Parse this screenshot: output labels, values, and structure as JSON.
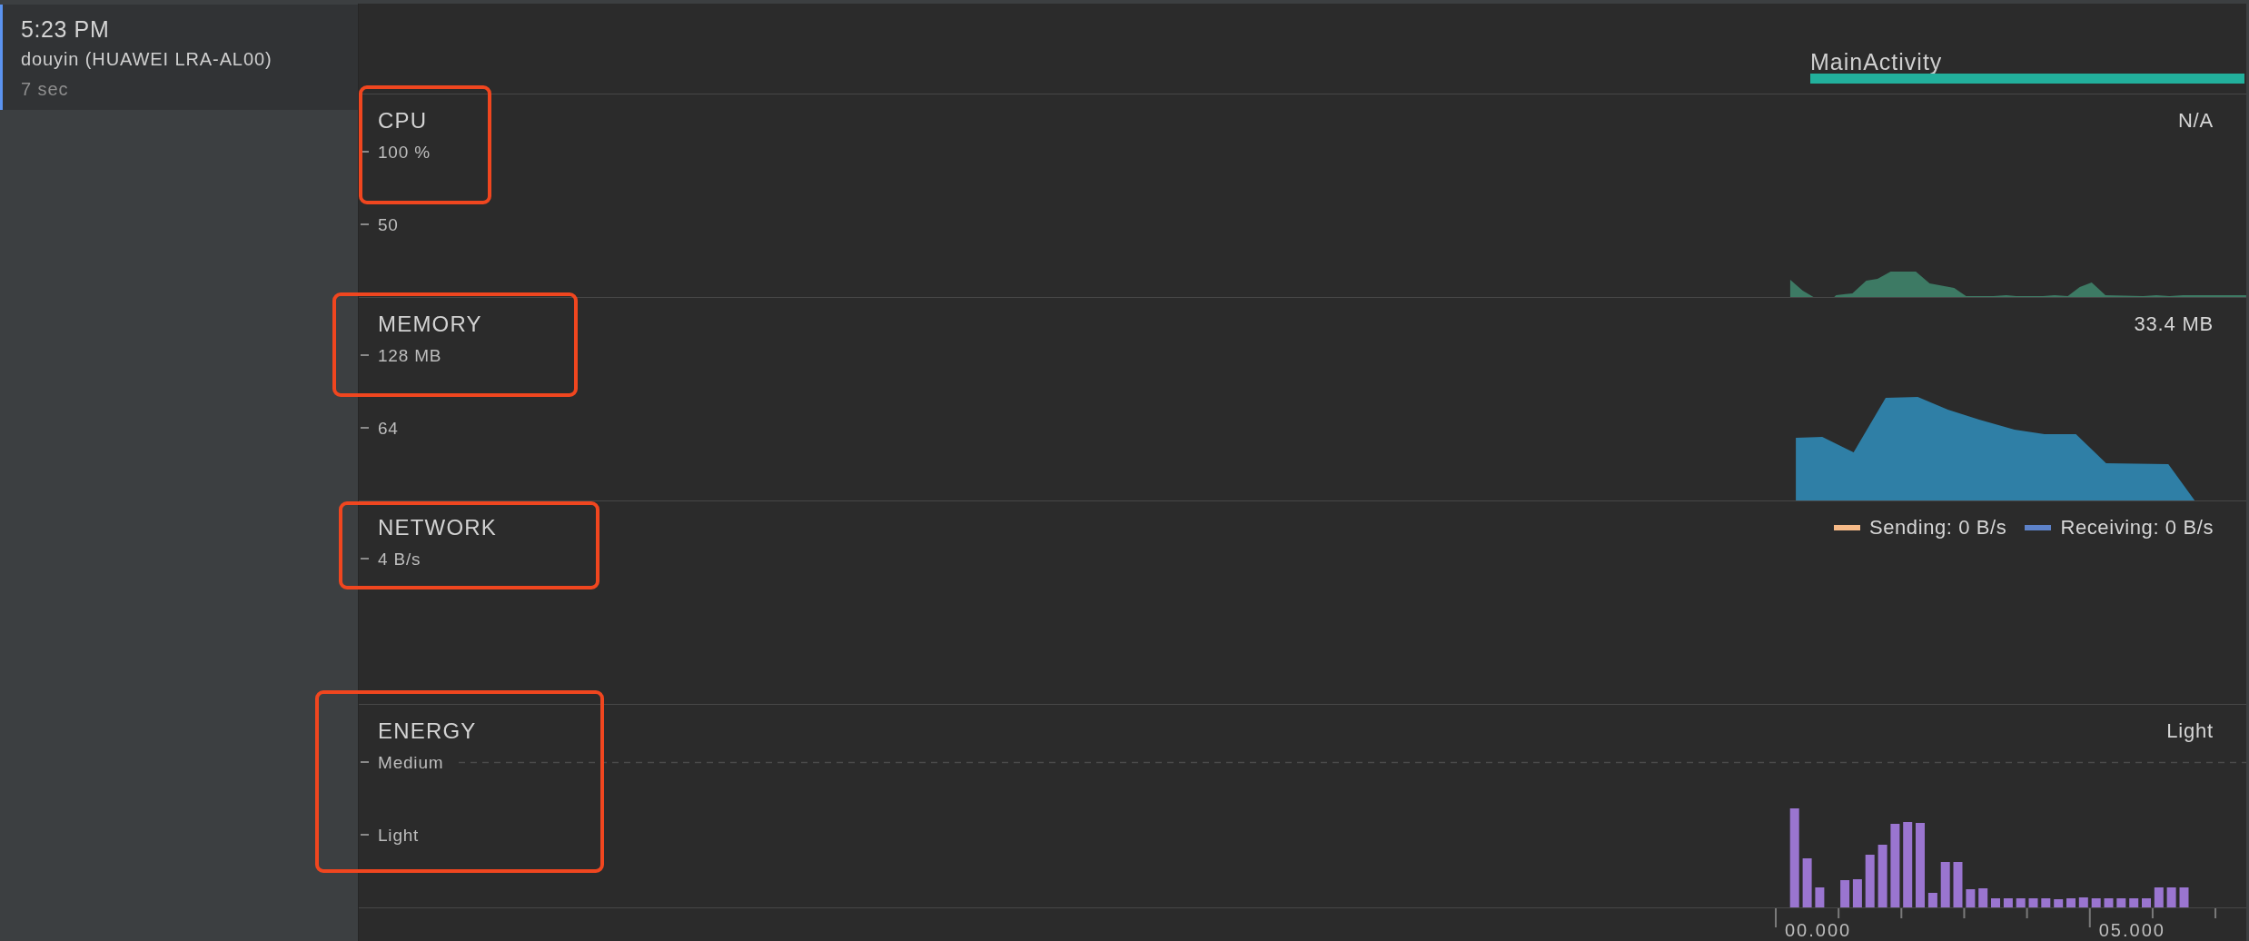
{
  "sessions": [
    {
      "time": "5:23 PM",
      "name": "douyin (HUAWEI LRA-AL00)",
      "duration": "7 sec",
      "selected": true
    }
  ],
  "activities": [
    {
      "name": "MainActivity"
    }
  ],
  "monitors": [
    {
      "kind": "cpu",
      "title": "CPU",
      "reading": "N/A",
      "highlighted": true,
      "tick_labels": [
        "100 %",
        "50"
      ]
    },
    {
      "kind": "memory",
      "title": "MEMORY",
      "reading": "33.4 MB",
      "highlighted": true,
      "tick_labels": [
        "128 MB",
        "64"
      ]
    },
    {
      "kind": "network",
      "title": "NETWORK",
      "highlighted": true,
      "tick_labels": [
        "4 B/s"
      ],
      "legend": [
        {
          "label": "Sending: 0 B/s",
          "color": "#f5b987"
        },
        {
          "label": "Receiving: 0 B/s",
          "color": "#5d82c9"
        }
      ]
    },
    {
      "kind": "energy",
      "title": "ENERGY",
      "reading": "Light",
      "highlighted": true,
      "tick_labels": [
        "Medium",
        "Light"
      ]
    }
  ],
  "time_axis": {
    "labels": [
      "00.000",
      "05.000"
    ]
  }
}
